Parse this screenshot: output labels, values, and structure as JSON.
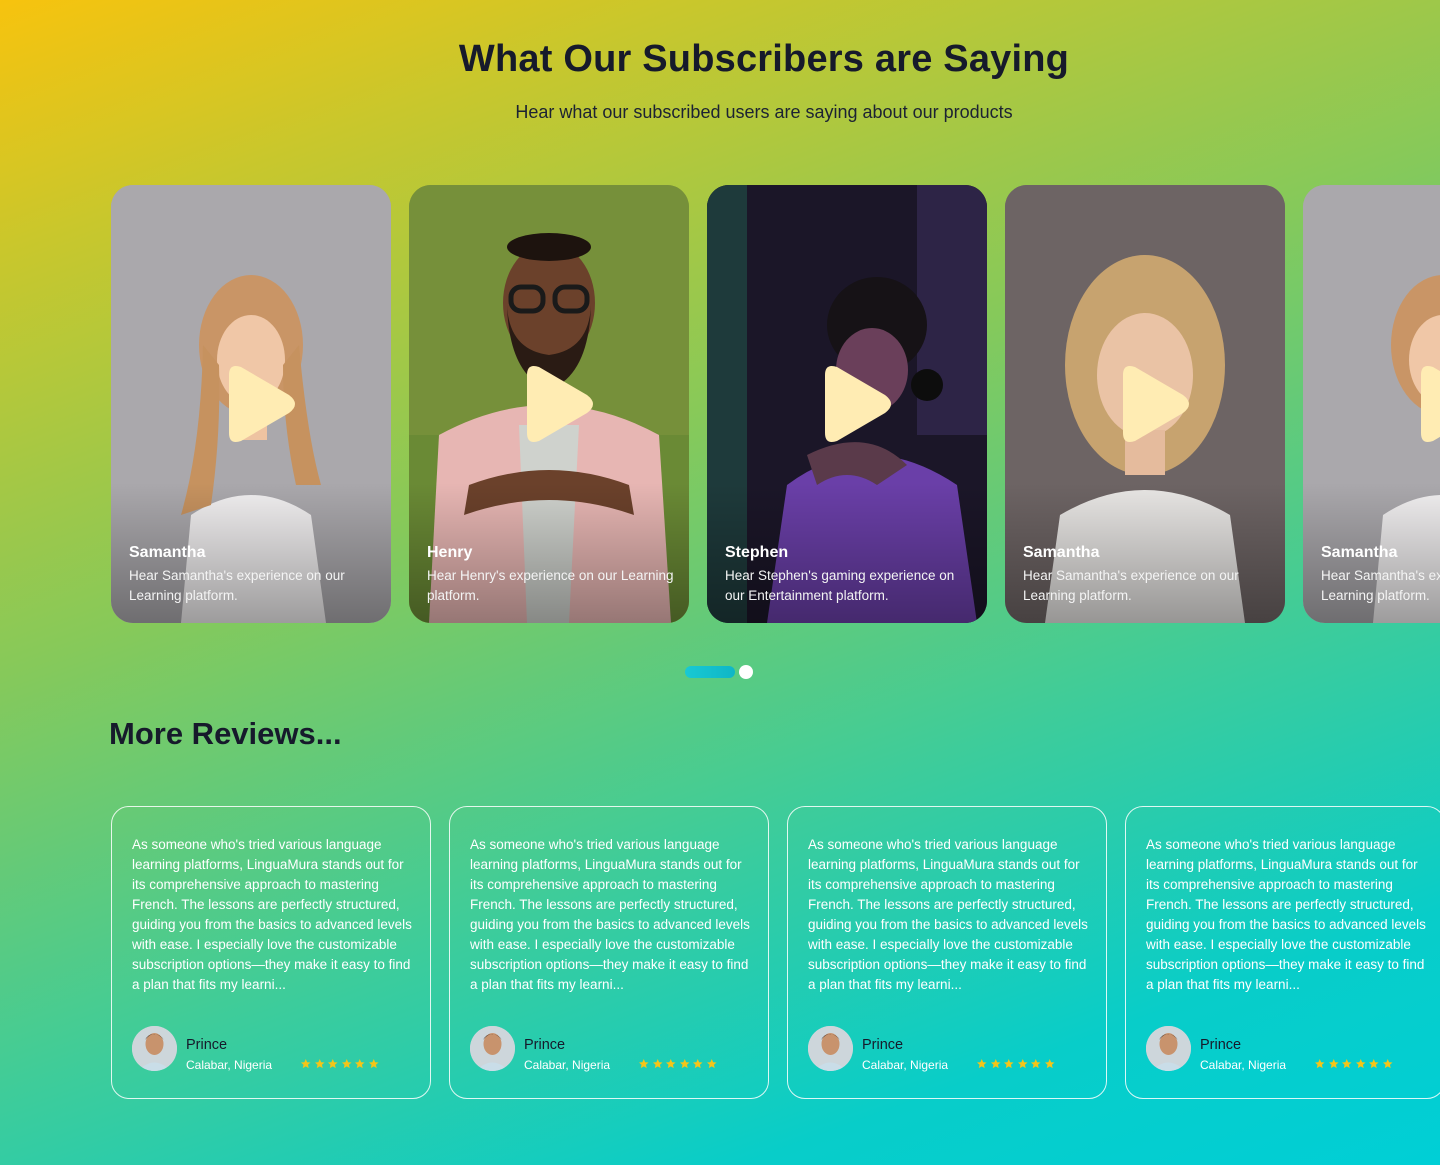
{
  "header": {
    "title": "What Our Subscribers are Saying",
    "subtitle": "Hear what our subscribed users are saying about our products"
  },
  "video_cards": [
    {
      "name": "Samantha",
      "description": "Hear Samantha's experience on our Learning platform.",
      "bg": "#a9a7ab",
      "icon": "play-icon"
    },
    {
      "name": "Henry",
      "description": "Hear Henry's experience on our Learning platform.",
      "bg": "#7b8f3a",
      "icon": "play-icon"
    },
    {
      "name": "Stephen",
      "description": "Hear Stephen's gaming experience on our Entertainment platform.",
      "bg": "#1f1a30",
      "icon": "play-icon"
    },
    {
      "name": "Samantha",
      "description": "Hear Samantha's experience on our Learning platform.",
      "bg": "#6f6666",
      "icon": "play-icon"
    },
    {
      "name": "Samantha",
      "description": "Hear Samantha's experience on our Learning platform.",
      "bg": "#a9a7ab",
      "icon": "play-icon"
    }
  ],
  "carousel": {
    "active_index": 0,
    "total": 2,
    "accent": "#18c9d4"
  },
  "reviews_section": {
    "title": "More Reviews..."
  },
  "reviews": [
    {
      "text": "As someone who's tried various language learning platforms, LinguaMura stands out for its comprehensive approach to mastering French. The lessons are perfectly structured, guiding you from the basics to advanced levels with ease. I especially love the customizable subscription options—they make it easy to find a plan that fits my learni...",
      "name": "Prince",
      "location": "Calabar, Nigeria",
      "rating": 6
    },
    {
      "text": "As someone who's tried various language learning platforms, LinguaMura stands out for its comprehensive approach to mastering French. The lessons are perfectly structured, guiding you from the basics to advanced levels with ease. I especially love the customizable subscription options—they make it easy to find a plan that fits my learni...",
      "name": "Prince",
      "location": "Calabar, Nigeria",
      "rating": 6
    },
    {
      "text": "As someone who's tried various language learning platforms, LinguaMura stands out for its comprehensive approach to mastering French. The lessons are perfectly structured, guiding you from the basics to advanced levels with ease. I especially love the customizable subscription options—they make it easy to find a plan that fits my learni...",
      "name": "Prince",
      "location": "Calabar, Nigeria",
      "rating": 6
    },
    {
      "text": "As someone who's tried various language learning platforms, LinguaMura stands out for its comprehensive approach to mastering French. The lessons are perfectly structured, guiding you from the basics to advanced levels with ease. I especially love the customizable subscription options—they make it easy to find a plan that fits my learni...",
      "name": "Prince",
      "location": "Calabar, Nigeria",
      "rating": 6
    }
  ],
  "colors": {
    "play_button": "#ffecb3",
    "star": "#f5c518",
    "text_dark": "#161a2b"
  }
}
